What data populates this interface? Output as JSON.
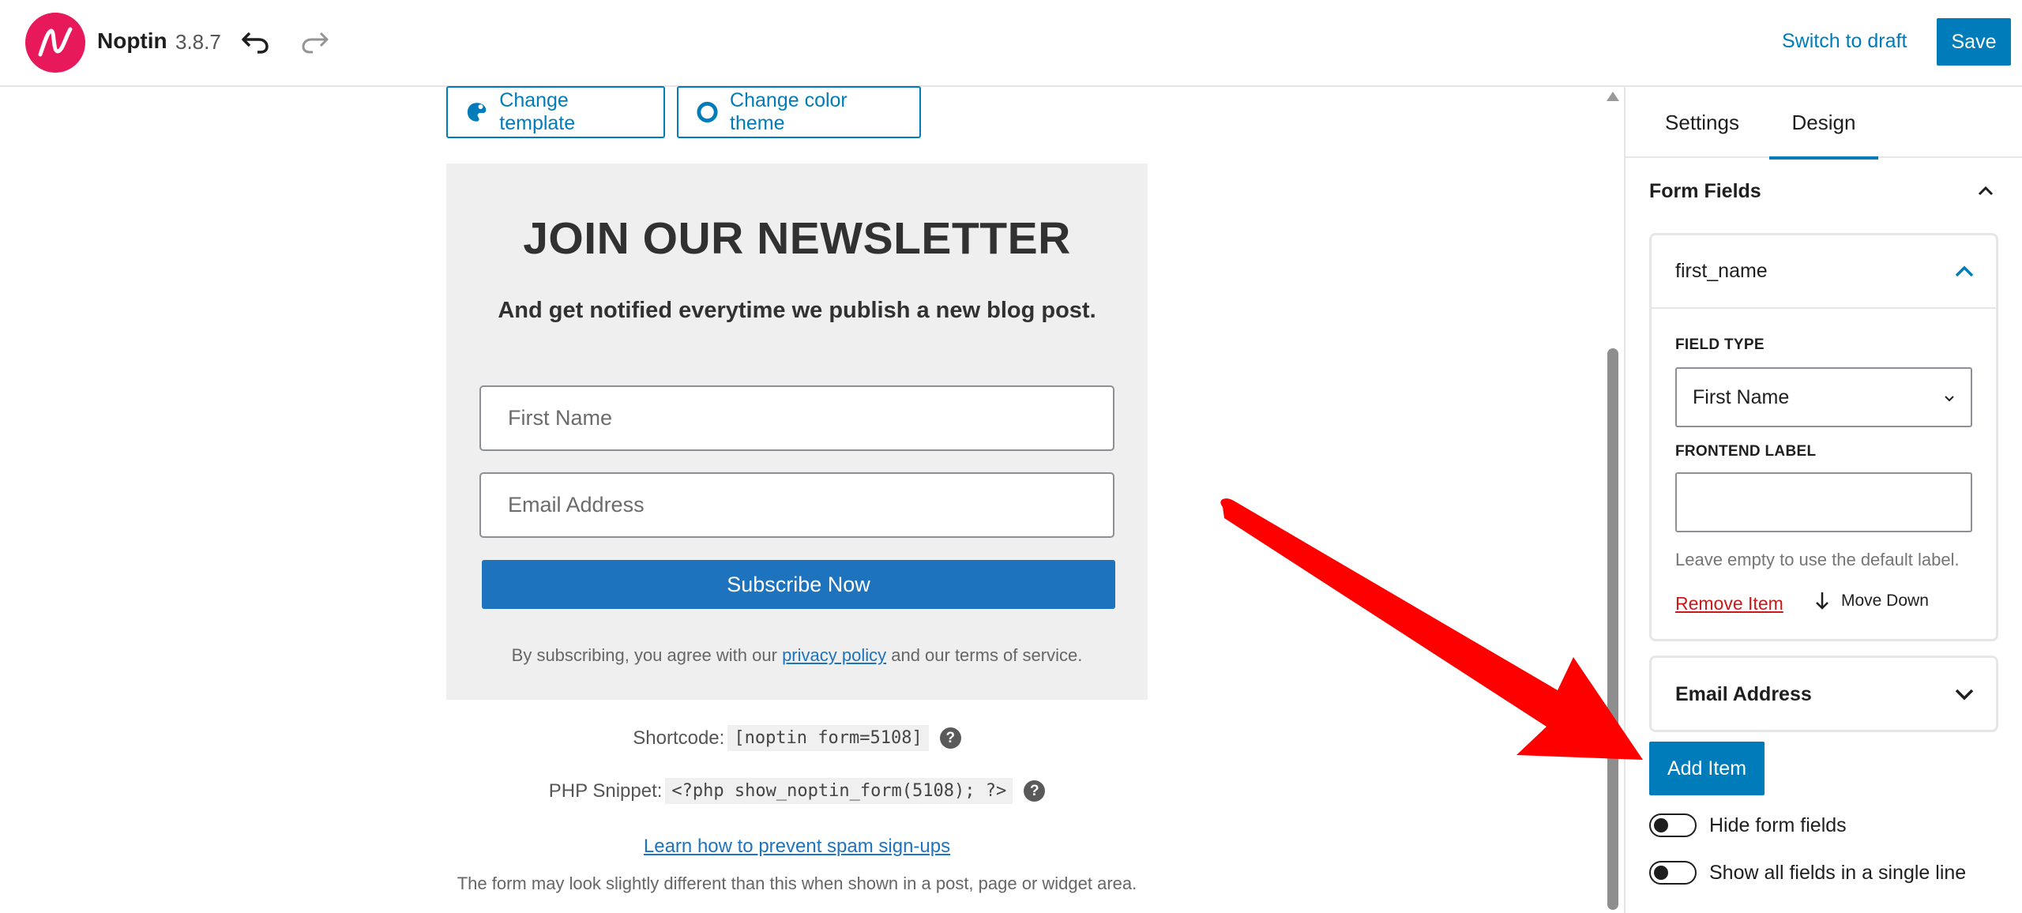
{
  "header": {
    "app_name": "Noptin",
    "version": "3.8.7",
    "switch_to_draft": "Switch to draft",
    "save_label": "Save"
  },
  "toolbar": {
    "change_template": "Change template",
    "change_color_theme": "Change color theme"
  },
  "form_preview": {
    "title": "JOIN OUR NEWSLETTER",
    "description": "And get notified everytime we publish a new blog post.",
    "first_name_placeholder": "First Name",
    "email_placeholder": "Email Address",
    "subscribe_label": "Subscribe Now",
    "consent_before": "By subscribing, you agree with our ",
    "consent_link": "privacy policy",
    "consent_after": " and our terms of service."
  },
  "embed": {
    "shortcode_label": "Shortcode:",
    "shortcode_value": "[noptin form=5108]",
    "php_label": "PHP Snippet:",
    "php_value": "<?php show_noptin_form(5108); ?>",
    "help_glyph": "?",
    "spam_link": "Learn how to prevent spam sign-ups",
    "disclaimer": "The form may look slightly different than this when shown in a post, page or widget area."
  },
  "sidebar": {
    "tabs": [
      {
        "label": "Settings",
        "active": false
      },
      {
        "label": "Design",
        "active": true
      }
    ],
    "section_title": "Form Fields",
    "fields": [
      {
        "name": "first_name",
        "expanded": true,
        "field_type_label": "FIELD TYPE",
        "field_type_value": "First Name",
        "frontend_label_label": "FRONTEND LABEL",
        "frontend_label_value": "",
        "hint": "Leave empty to use the default label.",
        "remove_label": "Remove Item",
        "move_down_label": "Move Down"
      },
      {
        "name": "Email Address",
        "expanded": false
      }
    ],
    "add_item_label": "Add Item",
    "toggles": [
      {
        "label": "Hide form fields",
        "on": false
      },
      {
        "label": "Show all fields in a single line",
        "on": false
      }
    ]
  },
  "colors": {
    "accent": "#007cba",
    "brand": "#e8195a",
    "form_button": "#1e73be",
    "danger": "#cc1818",
    "annotation_arrow": "#ff0000"
  },
  "icons": {
    "logo": "noptin-logo",
    "undo": "undo-icon",
    "redo": "redo-icon",
    "template": "palette-icon",
    "color_theme": "circle-icon",
    "help": "help-icon",
    "chevron_up": "chevron-up-icon",
    "chevron_down": "chevron-down-icon",
    "arrow_down": "arrow-down-icon"
  }
}
